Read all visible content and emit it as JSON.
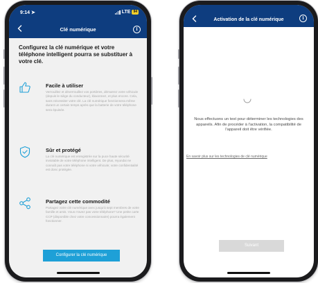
{
  "left_screen": {
    "status": {
      "time": "9:14",
      "network": "LTE",
      "battery": "94"
    },
    "header": {
      "title": "Clé numérique"
    },
    "intro": "Configurez la clé numérique et votre téléphone intelligent pourra se substituer à votre clé.",
    "features": [
      {
        "icon": "thumbs-up-icon",
        "title": "Facile à utiliser",
        "description": "Verrouillez et déverrouillez vos portières, démarrez votre véhicule (depuis le siège du conducteur), klaxonnez, et plus encore. Cela, sans nécessiter votre clé. La clé numérique fonctionnera même durant un certain temps après que la batterie de votre téléphone sera épuisée."
      },
      {
        "icon": "shield-check-icon",
        "title": "Sûr et protégé",
        "description": "La clé numérique est enregistrée sur la puce haute sécurité inviolable de votre téléphone intelligent. De plus, Hyundai ne connaît pas votre téléphone ni votre véhicule; votre confidentialité est donc protégée."
      },
      {
        "icon": "share-icon",
        "title": "Partagez cette commodité",
        "description": "Partagez votre clé numérique avec jusqu'à sept membres de votre famille et amis. Vous n'avez pas votre téléphone? Une petite carte CCP (disponible chez votre concessionnaire) pourra également fonctionner."
      }
    ],
    "cta_label": "Configurer la clé numérique"
  },
  "right_screen": {
    "header": {
      "title": "Activation de la clé numérique"
    },
    "message": "Nous effectuons un test pour déterminer les technologies des appareils. Afin de procéder à l'activation, la compatibilité de l'appareil doit être vérifiée.",
    "link": "En savoir plus sur les technologies de clé numérique",
    "next_label": "Suivant"
  },
  "colors": {
    "header_blue": "#0e3d7f",
    "accent_cyan": "#1ea0d7",
    "battery_yellow": "#f4cf2a",
    "disabled_gray": "#d9d9d9"
  }
}
